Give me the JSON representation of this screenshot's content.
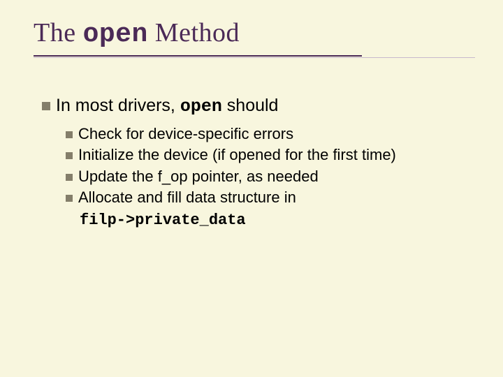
{
  "title": {
    "pre": "The ",
    "mono": "open",
    "post": " Method"
  },
  "intro": {
    "pre": "In most drivers, ",
    "mono": "open",
    "post": " should"
  },
  "bullets": [
    "Check for device-specific errors",
    "Initialize the device (if opened for the first time)",
    "Update the f_op pointer, as needed",
    "Allocate and fill data structure in"
  ],
  "code_line": "filp->private_data"
}
